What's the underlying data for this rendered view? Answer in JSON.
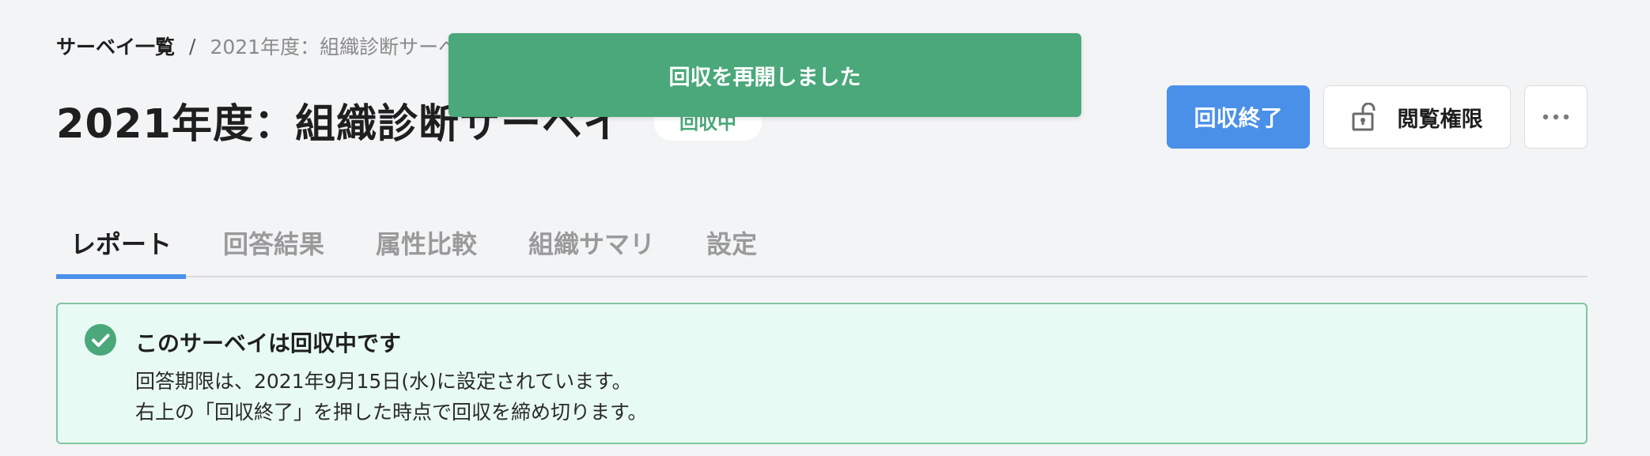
{
  "breadcrumb": {
    "root": "サーベイ一覧",
    "separator": "/",
    "current": "2021年度：組織診断サーベイ"
  },
  "survey": {
    "title": "2021年度：組織診断サーベイ",
    "status": "回収中"
  },
  "toast": {
    "message": "回収を再開しました"
  },
  "actions": {
    "close_collection": "回収終了",
    "view_permission": "閲覧権限",
    "more": "more-icon"
  },
  "tabs": [
    {
      "label": "レポート",
      "active": true
    },
    {
      "label": "回答結果",
      "active": false
    },
    {
      "label": "属性比較",
      "active": false
    },
    {
      "label": "組織サマリ",
      "active": false
    },
    {
      "label": "設定",
      "active": false
    }
  ],
  "notice": {
    "title": "このサーベイは回収中です",
    "line1": "回答期限は、2021年9月15日(水)に設定されています。",
    "line2": "右上の「回収終了」を押した時点で回収を締め切ります。",
    "icon": "check-circle-icon"
  },
  "colors": {
    "primary": "#4a90e9",
    "success": "#4aa87a",
    "notice_bg": "#e8faf4",
    "notice_border": "#7fc6a2",
    "background": "#f3f4f6"
  }
}
